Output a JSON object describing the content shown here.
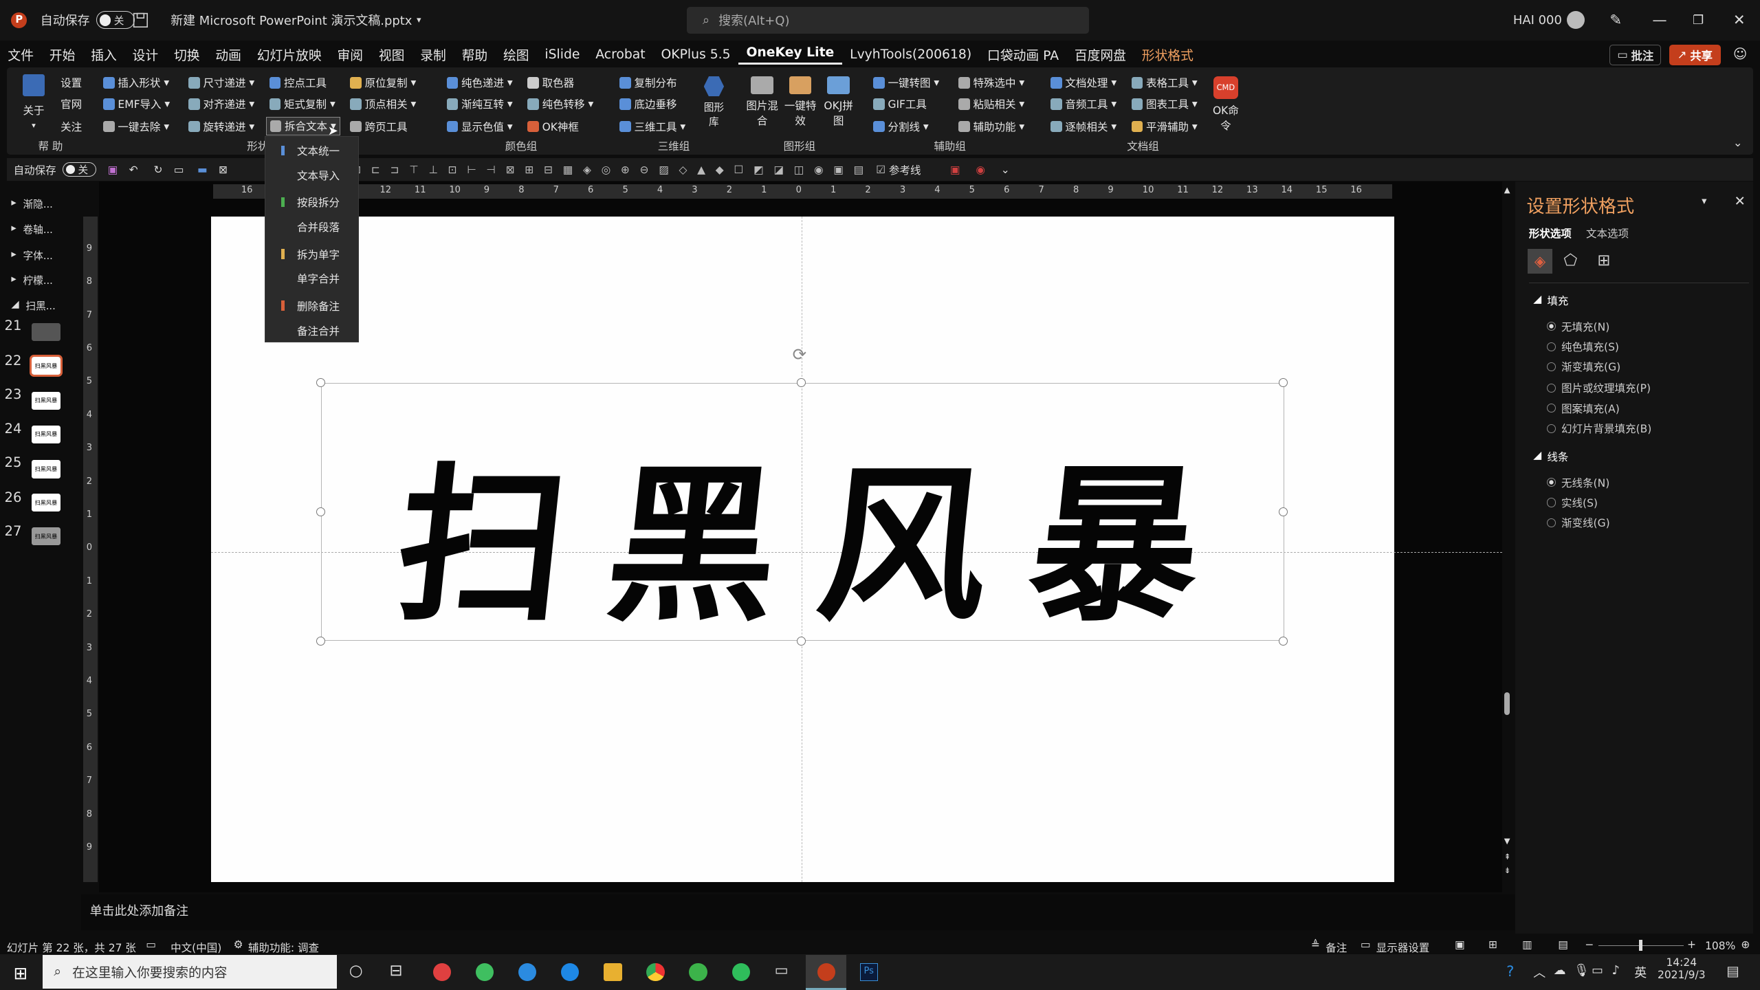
{
  "titlebar": {
    "autosave_label": "自动保存",
    "autosave_state": "关",
    "filename": "新建 Microsoft PowerPoint 演示文稿.pptx",
    "search_placeholder": "搜索(Alt+Q)",
    "user": "HAI 000"
  },
  "menu": [
    "文件",
    "开始",
    "插入",
    "设计",
    "切换",
    "动画",
    "幻灯片放映",
    "审阅",
    "视图",
    "录制",
    "帮助",
    "绘图",
    "iSlide",
    "Acrobat",
    "OKPlus 5.5",
    "OneKey Lite",
    "LvyhTools(200618)",
    "口袋动画 PA",
    "百度网盘",
    "形状格式"
  ],
  "menu_active": "OneKey Lite",
  "menu_right": {
    "comments": "批注",
    "share": "共享"
  },
  "ribbon": {
    "about": "关于",
    "col_help": [
      "设置",
      "官网",
      "关注"
    ],
    "shape_col1": [
      "插入形状",
      "EMF导入",
      "一键去除"
    ],
    "shape_col2": [
      "尺寸递进",
      "对齐递进",
      "旋转递进"
    ],
    "shape_col3": [
      "控点工具",
      "矩式复制",
      "拆合文本"
    ],
    "shape_col4": [
      "原位复制",
      "顶点相关",
      "跨页工具"
    ],
    "color_col1": [
      "纯色递进",
      "渐纯互转",
      "显示色值"
    ],
    "color_col2": [
      "取色器",
      "纯色转移",
      "OK神框"
    ],
    "three_col": [
      "复制分布",
      "底边垂移",
      "三维工具"
    ],
    "graph_lib": "图形库",
    "img_mix": "图片混合",
    "one_effect": "一键特效",
    "ok_collage": "OKJ拼图",
    "aux_col1": [
      "一键转图",
      "GIF工具",
      "分割线"
    ],
    "aux_col2": [
      "特殊选中",
      "粘贴相关",
      "辅助功能"
    ],
    "doc_col1": [
      "文档处理",
      "音频工具",
      "逐帧相关"
    ],
    "doc_col2": [
      "表格工具",
      "图表工具",
      "平滑辅助"
    ],
    "ok_cmd": "OK命令",
    "cmd_badge": "CMD",
    "groups": {
      "help": "帮 助",
      "shape": "形状",
      "color": "颜色组",
      "three": "三维组",
      "graph": "图形组",
      "aux": "辅助组",
      "doc": "文档组"
    }
  },
  "qat": {
    "autosave": "自动保存",
    "state": "关",
    "ref_line": "参考线"
  },
  "dropdown": [
    "文本统一",
    "文本导入",
    "按段拆分",
    "合并段落",
    "拆为单字",
    "单字合并",
    "删除备注",
    "备注合并"
  ],
  "ruler_h": [
    "16",
    "15",
    "14",
    "13",
    "12",
    "11",
    "10",
    "9",
    "8",
    "7",
    "6",
    "5",
    "4",
    "3",
    "2",
    "1",
    "0",
    "1",
    "2",
    "3",
    "4",
    "5",
    "6",
    "7",
    "8",
    "9",
    "10",
    "11",
    "12",
    "13",
    "14",
    "15",
    "16"
  ],
  "ruler_v": [
    "9",
    "8",
    "7",
    "6",
    "5",
    "4",
    "3",
    "2",
    "1",
    "0",
    "1",
    "2",
    "3",
    "4",
    "5",
    "6",
    "7",
    "8",
    "9"
  ],
  "outline": [
    "渐隐...",
    "卷轴...",
    "字体...",
    "柠檬...",
    "扫黑..."
  ],
  "thumbs": [
    {
      "num": "21",
      "label": ""
    },
    {
      "num": "22",
      "label": "扫黑风暴"
    },
    {
      "num": "23",
      "label": "扫黑风暴"
    },
    {
      "num": "24",
      "label": "扫黑风暴"
    },
    {
      "num": "25",
      "label": "扫黑风暴"
    },
    {
      "num": "26",
      "label": "扫黑风暴"
    },
    {
      "num": "27",
      "label": "扫黑风暴"
    }
  ],
  "slide_text": [
    "扫",
    "黑",
    "风",
    "暴"
  ],
  "pane": {
    "title": "设置形状格式",
    "tab_shape": "形状选项",
    "tab_text": "文本选项",
    "fill_header": "填充",
    "fill_options": [
      "无填充(N)",
      "纯色填充(S)",
      "渐变填充(G)",
      "图片或纹理填充(P)",
      "图案填充(A)",
      "幻灯片背景填充(B)"
    ],
    "line_header": "线条",
    "line_options": [
      "无线条(N)",
      "实线(S)",
      "渐变线(G)"
    ]
  },
  "notes_placeholder": "单击此处添加备注",
  "status": {
    "slide_info": "幻灯片 第 22 张，共 27 张",
    "language": "中文(中国)",
    "accessibility": "辅助功能: 调查",
    "notes": "备注",
    "display_settings": "显示器设置",
    "zoom": "108%"
  },
  "taskbar": {
    "search_placeholder": "在这里输入你要搜索的内容",
    "time": "14:24",
    "date": "2021/9/3",
    "ime": "英"
  }
}
